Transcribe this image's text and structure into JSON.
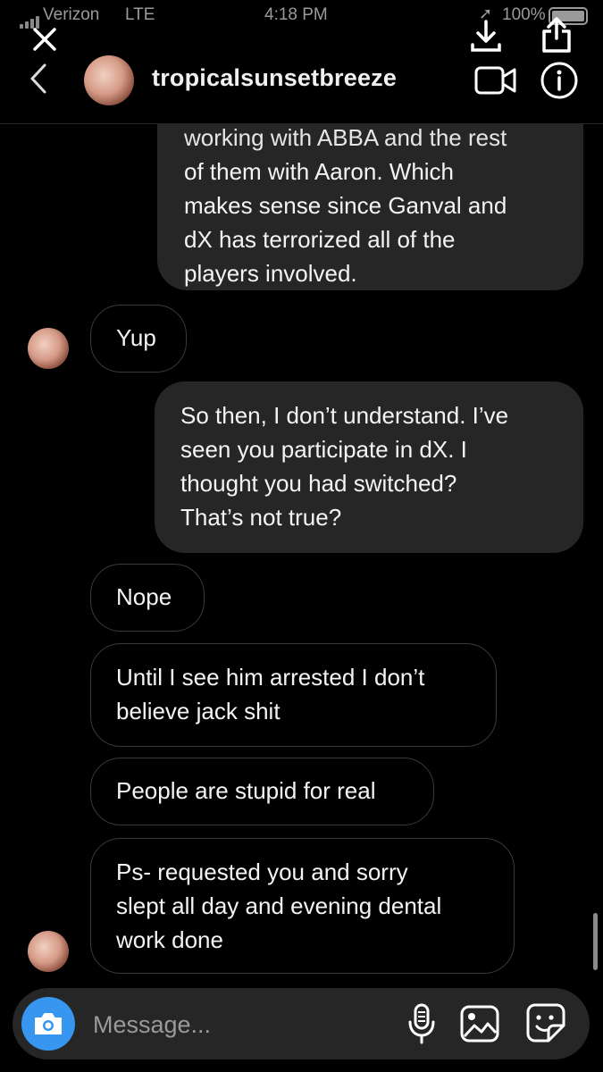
{
  "status_bar": {
    "carrier": "Verizon",
    "network": "LTE",
    "time": "4:18 PM",
    "battery": "100%"
  },
  "header": {
    "username": "tropicalsunsetbreeze",
    "icons": [
      "close-icon",
      "download-icon",
      "share-icon",
      "back-icon",
      "video-call-icon",
      "info-icon"
    ]
  },
  "messages": [
    {
      "direction": "sent",
      "lines": [
        "working with ABBA and the rest",
        "of them with Aaron. Which",
        "makes sense since Ganval and",
        "dX has terrorized all of the",
        "players involved."
      ]
    },
    {
      "direction": "received",
      "lines": [
        "Yup"
      ]
    },
    {
      "direction": "sent",
      "lines": [
        "So then, I don’t understand. I’ve",
        "seen you participate in dX. I",
        "thought you had switched?",
        "That’s not true?"
      ]
    },
    {
      "direction": "received",
      "lines": [
        "Nope"
      ]
    },
    {
      "direction": "received",
      "lines": [
        "Until I see him arrested I don’t",
        "believe jack shit"
      ]
    },
    {
      "direction": "received",
      "lines": [
        "People are stupid for real"
      ]
    },
    {
      "direction": "received",
      "lines": [
        "Ps- requested you and sorry",
        "slept all day and evening dental",
        "work done"
      ]
    }
  ],
  "composer": {
    "placeholder": "Message...",
    "icons": [
      "camera-icon",
      "microphone-icon",
      "gallery-icon",
      "sticker-icon"
    ]
  },
  "colors": {
    "background": "#000000",
    "sent_bubble": "#262626",
    "received_border": "#3a3a3a",
    "camera_button": "#3797f0"
  }
}
